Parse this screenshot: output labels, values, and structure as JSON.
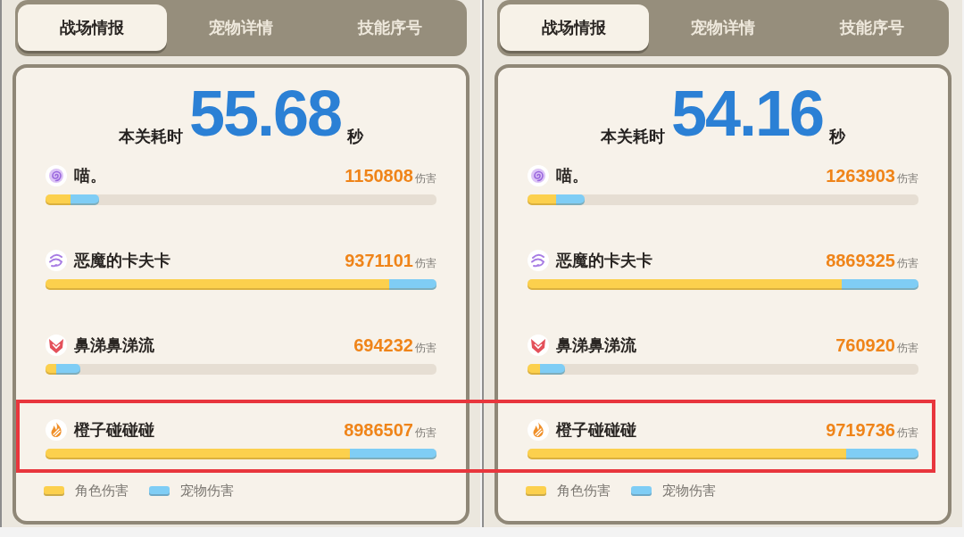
{
  "panels": [
    {
      "tabs": [
        {
          "label": "战场情报",
          "selected": true
        },
        {
          "label": "宠物详情",
          "selected": false
        },
        {
          "label": "技能序号",
          "selected": false
        }
      ],
      "time": {
        "label": "本关耗时",
        "value": "55.68",
        "unit": "秒"
      },
      "rows": [
        {
          "name": "喵。",
          "damage": "1150808",
          "unit": "伤害",
          "highlighted": false,
          "segments": [
            {
              "color": "#fcd04d",
              "level": 0.065
            },
            {
              "color": "#7fcdf5",
              "level": 0.072
            }
          ]
        },
        {
          "name": "恶魔的卡夫卡",
          "damage": "9371101",
          "unit": "伤害",
          "highlighted": false,
          "segments": [
            {
              "color": "#fcd04d",
              "level": 0.879
            },
            {
              "color": "#7fcdf5",
              "level": 0.121
            }
          ]
        },
        {
          "name": "鼻涕鼻涕流",
          "damage": "694232",
          "unit": "伤害",
          "highlighted": false,
          "segments": [
            {
              "color": "#fcd04d",
              "level": 0.027
            },
            {
              "color": "#7fcdf5",
              "level": 0.062
            }
          ]
        },
        {
          "name": "橙子碰碰碰",
          "damage": "8986507",
          "unit": "伤害",
          "highlighted": true,
          "segments": [
            {
              "color": "#fcd04d",
              "level": 0.779
            },
            {
              "color": "#7fcdf5",
              "level": 0.221
            }
          ]
        }
      ],
      "legend": [
        {
          "label": "角色伤害",
          "color": "#fcd04d"
        },
        {
          "label": "宠物伤害",
          "color": "#7fcdf5"
        }
      ]
    },
    {
      "tabs": [
        {
          "label": "战场情报",
          "selected": true
        },
        {
          "label": "宠物详情",
          "selected": false
        },
        {
          "label": "技能序号",
          "selected": false
        }
      ],
      "time": {
        "label": "本关耗时",
        "value": "54.16",
        "unit": "秒"
      },
      "rows": [
        {
          "name": "喵。",
          "damage": "1263903",
          "unit": "伤害",
          "highlighted": false,
          "segments": [
            {
              "color": "#fcd04d",
              "level": 0.072
            },
            {
              "color": "#7fcdf5",
              "level": 0.075
            }
          ]
        },
        {
          "name": "恶魔的卡夫卡",
          "damage": "8869325",
          "unit": "伤害",
          "highlighted": false,
          "segments": [
            {
              "color": "#fcd04d",
              "level": 0.803
            },
            {
              "color": "#7fcdf5",
              "level": 0.197
            }
          ]
        },
        {
          "name": "鼻涕鼻涕流",
          "damage": "760920",
          "unit": "伤害",
          "highlighted": false,
          "segments": [
            {
              "color": "#fcd04d",
              "level": 0.032
            },
            {
              "color": "#7fcdf5",
              "level": 0.064
            }
          ]
        },
        {
          "name": "橙子碰碰碰",
          "damage": "9719736",
          "unit": "伤害",
          "highlighted": true,
          "segments": [
            {
              "color": "#fcd04d",
              "level": 0.816
            },
            {
              "color": "#7fcdf5",
              "level": 0.184
            }
          ]
        }
      ],
      "legend": [
        {
          "label": "角色伤害",
          "color": "#fcd04d"
        },
        {
          "label": "宠物伤害",
          "color": "#7fcdf5"
        }
      ]
    }
  ]
}
